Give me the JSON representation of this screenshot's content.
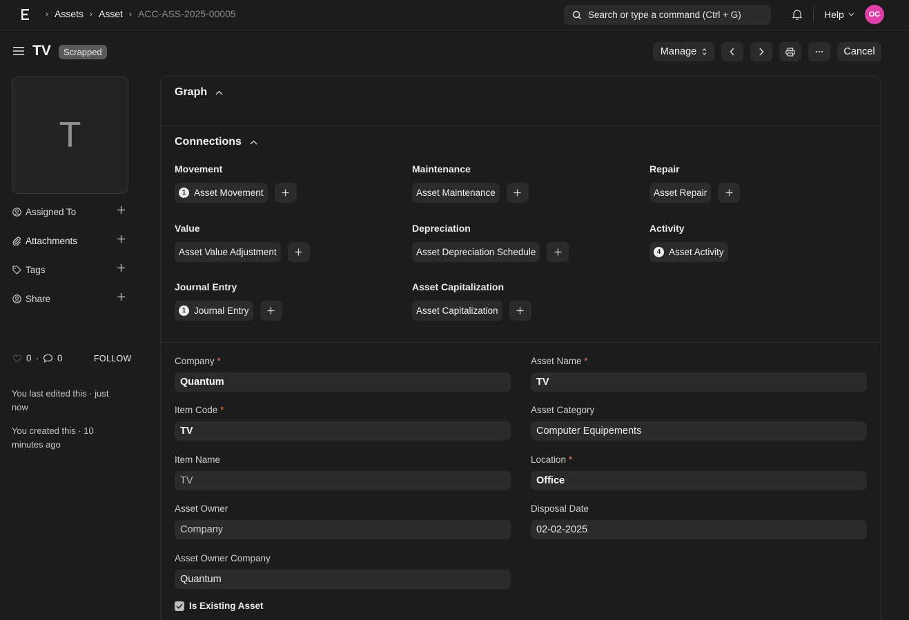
{
  "breadcrumb": [
    "Assets",
    "Asset",
    "ACC-ASS-2025-00005"
  ],
  "search": {
    "placeholder": "Search or type a command (Ctrl + G)"
  },
  "nav": {
    "help_label": "Help",
    "user_initials": "OC"
  },
  "header": {
    "title": "TV",
    "status": "Scrapped"
  },
  "toolbar": {
    "manage_label": "Manage",
    "cancel_label": "Cancel"
  },
  "sidebar": {
    "avatar_letter": "T",
    "items": [
      {
        "label": "Assigned To",
        "icon": "user-plus-icon"
      },
      {
        "label": "Attachments",
        "icon": "paperclip-icon"
      },
      {
        "label": "Tags",
        "icon": "tag-icon"
      },
      {
        "label": "Share",
        "icon": "share-user-icon"
      }
    ],
    "likes_count": "0",
    "comments_count": "0",
    "follow_label": "FOLLOW",
    "last_edited": "You last edited this · just now",
    "created": "You created this · 10 minutes ago"
  },
  "sections": {
    "graph": "Graph",
    "connections": "Connections"
  },
  "connections": [
    {
      "group": "Movement",
      "link": "Asset Movement",
      "count": "1"
    },
    {
      "group": "Maintenance",
      "link": "Asset Maintenance",
      "count": ""
    },
    {
      "group": "Repair",
      "link": "Asset Repair",
      "count": ""
    },
    {
      "group": "Value",
      "link": "Asset Value Adjustment",
      "count": ""
    },
    {
      "group": "Depreciation",
      "link": "Asset Depreciation Schedule",
      "count": ""
    },
    {
      "group": "Activity",
      "link": "Asset Activity",
      "count": "4"
    },
    {
      "group": "Journal Entry",
      "link": "Journal Entry",
      "count": "1"
    },
    {
      "group": "Asset Capitalization",
      "link": "Asset Capitalization",
      "count": ""
    }
  ],
  "fields": {
    "company": {
      "label": "Company",
      "value": "Quantum"
    },
    "asset_name": {
      "label": "Asset Name",
      "value": "TV"
    },
    "item_code": {
      "label": "Item Code",
      "value": "TV"
    },
    "asset_category": {
      "label": "Asset Category",
      "value": "Computer Equipements"
    },
    "item_name": {
      "label": "Item Name",
      "value": "TV"
    },
    "location": {
      "label": "Location",
      "value": "Office"
    },
    "asset_owner": {
      "label": "Asset Owner",
      "value": "Company"
    },
    "disposal_date": {
      "label": "Disposal Date",
      "value": "02-02-2025"
    },
    "asset_owner_company": {
      "label": "Asset Owner Company",
      "value": "Quantum"
    },
    "is_existing_asset": {
      "label": "Is Existing Asset",
      "checked": true
    }
  },
  "colors": {
    "accent": "#e040a8",
    "required": "#f07b5a",
    "background": "#1c1c1c",
    "control": "#2b2b2b"
  }
}
